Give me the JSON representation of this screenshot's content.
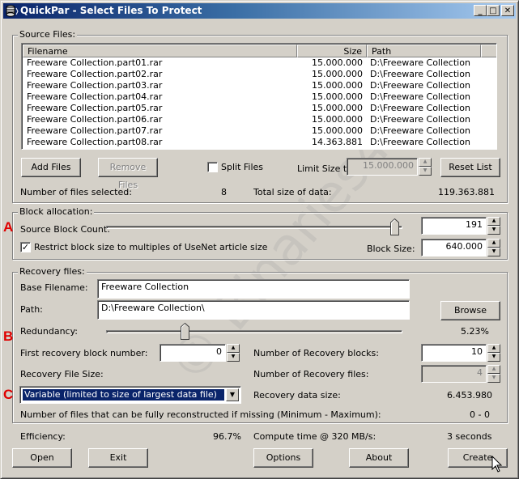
{
  "window": {
    "title": "QuickPar - Select Files To Protect",
    "controls": {
      "minimize": "_",
      "maximize": "□",
      "close": "✕"
    }
  },
  "source_files": {
    "group_label": "Source Files:",
    "columns": [
      "Filename",
      "Size",
      "Path"
    ],
    "rows": [
      {
        "filename": "Freeware Collection.part01.rar",
        "size": "15.000.000",
        "path": "D:\\Freeware Collection"
      },
      {
        "filename": "Freeware Collection.part02.rar",
        "size": "15.000.000",
        "path": "D:\\Freeware Collection"
      },
      {
        "filename": "Freeware Collection.part03.rar",
        "size": "15.000.000",
        "path": "D:\\Freeware Collection"
      },
      {
        "filename": "Freeware Collection.part04.rar",
        "size": "15.000.000",
        "path": "D:\\Freeware Collection"
      },
      {
        "filename": "Freeware Collection.part05.rar",
        "size": "15.000.000",
        "path": "D:\\Freeware Collection"
      },
      {
        "filename": "Freeware Collection.part06.rar",
        "size": "15.000.000",
        "path": "D:\\Freeware Collection"
      },
      {
        "filename": "Freeware Collection.part07.rar",
        "size": "15.000.000",
        "path": "D:\\Freeware Collection"
      },
      {
        "filename": "Freeware Collection.part08.rar",
        "size": "14.363.881",
        "path": "D:\\Freeware Collection"
      }
    ],
    "add_files": "Add Files",
    "remove_files": "Remove Files",
    "split_files_label": "Split Files",
    "split_files_checked": false,
    "limit_size_label": "Limit Size to:",
    "limit_size_value": "15.000.000",
    "reset_list": "Reset List",
    "files_selected_label": "Number of files selected:",
    "files_selected_value": "8",
    "total_size_label": "Total size of data:",
    "total_size_value": "119.363.881"
  },
  "block_allocation": {
    "group_label": "Block allocation:",
    "marker": "A",
    "source_block_count_label": "Source Block Count:",
    "source_block_count_value": "191",
    "source_block_slider_fraction": 0.99,
    "restrict_label": "Restrict block size to multiples of UseNet article size",
    "restrict_checked": true,
    "block_size_label": "Block Size:",
    "block_size_value": "640.000"
  },
  "recovery_files": {
    "group_label": "Recovery files:",
    "base_filename_label": "Base Filename:",
    "base_filename_value": "Freeware Collection",
    "path_label": "Path:",
    "path_value": "D:\\Freeware Collection\\",
    "browse": "Browse",
    "marker_b": "B",
    "redundancy_label": "Redundancy:",
    "redundancy_value": "5.23%",
    "redundancy_slider_fraction": 0.26,
    "first_block_label": "First recovery block number:",
    "first_block_value": "0",
    "num_blocks_label": "Number of Recovery blocks:",
    "num_blocks_value": "10",
    "file_size_label": "Recovery File Size:",
    "num_files_label": "Number of Recovery files:",
    "num_files_value": "4",
    "marker_c": "C",
    "file_size_option": "Variable (limited to size of largest data file)",
    "data_size_label": "Recovery data size:",
    "data_size_value": "6.453.980",
    "reconstruct_label": "Number of files that can be fully reconstructed if missing (Minimum - Maximum):",
    "reconstruct_value": "0 - 0"
  },
  "footer": {
    "efficiency_label": "Efficiency:",
    "efficiency_value": "96.7%",
    "compute_label": "Compute time @ 320 MB/s:",
    "compute_value": "3 seconds",
    "buttons": {
      "open": "Open",
      "exit": "Exit",
      "options": "Options",
      "about": "About",
      "create": "Create"
    }
  },
  "watermark": "© Binaries4all"
}
